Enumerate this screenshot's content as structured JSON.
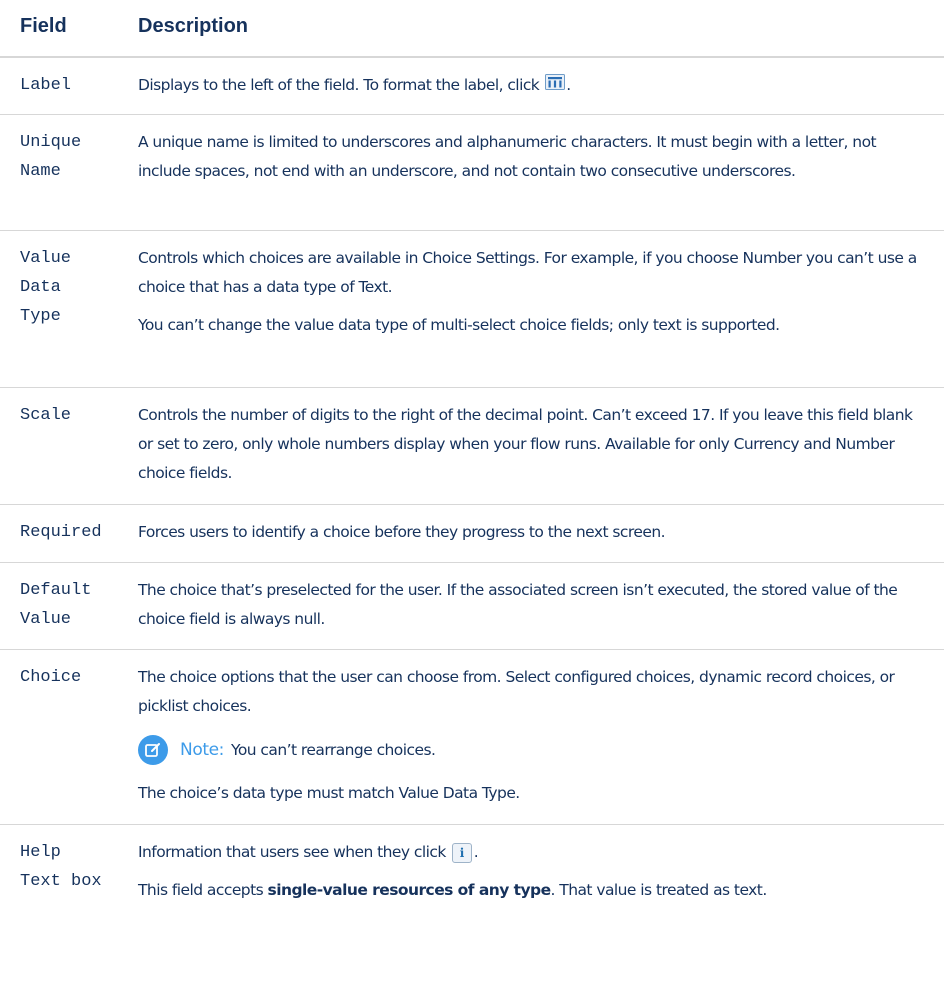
{
  "header": {
    "field": "Field",
    "description": "Description"
  },
  "rows": {
    "label": {
      "field": "Label",
      "desc_before_icon": "Displays to the left of the field. To format the label, click",
      "desc_after_icon": "."
    },
    "unique_name": {
      "field_line1": "Unique",
      "field_line2": "Name",
      "desc": "A unique name is limited to underscores and alphanumeric characters. It must begin with a letter, not include spaces, not end with an underscore, and not contain two consecutive underscores."
    },
    "value_data_type": {
      "field_line1": "Value",
      "field_line2": "Data",
      "field_line3": "Type",
      "desc_p1": "Controls which choices are available in Choice Settings. For example, if you choose Number you can’t use a choice that has a data type of Text.",
      "desc_p2": "You can’t change the value data type of multi-select choice fields; only text is supported."
    },
    "scale": {
      "field": "Scale",
      "desc": "Controls the number of digits to the right of the decimal point. Can’t exceed 17. If you leave this field blank or set to zero, only whole numbers display when your flow runs. Available for only Currency and Number choice fields."
    },
    "required": {
      "field": "Required",
      "desc": "Forces users to identify a choice before they progress to the next screen."
    },
    "default_value": {
      "field_line1": "Default",
      "field_line2": "Value",
      "desc": "The choice that’s preselected for the user. If the associated screen isn’t executed, the stored value of the choice field is always null."
    },
    "choice": {
      "field": "Choice",
      "desc_p1": "The choice options that the user can choose from. Select configured choices, dynamic record choices, or picklist choices.",
      "note_label": "Note:",
      "note_text": "You can’t rearrange choices.",
      "desc_p2": "The choice’s data type must match Value Data Type."
    },
    "help_text": {
      "field_line1": "Help",
      "field_line2": "Text box",
      "desc_p1_before_icon": "Information that users see when they click",
      "desc_p1_after_icon": ".",
      "desc_p2_prefix": "This field accepts",
      "desc_p2_bold": "single-value resources of any type",
      "desc_p2_suffix": ". That value is treated as text."
    }
  },
  "icons": {
    "format_icon": "format-columns-icon",
    "info_icon": "info-icon",
    "info_glyph": "i",
    "note_icon": "note-edit-icon",
    "note_color": "#3d9be9"
  }
}
